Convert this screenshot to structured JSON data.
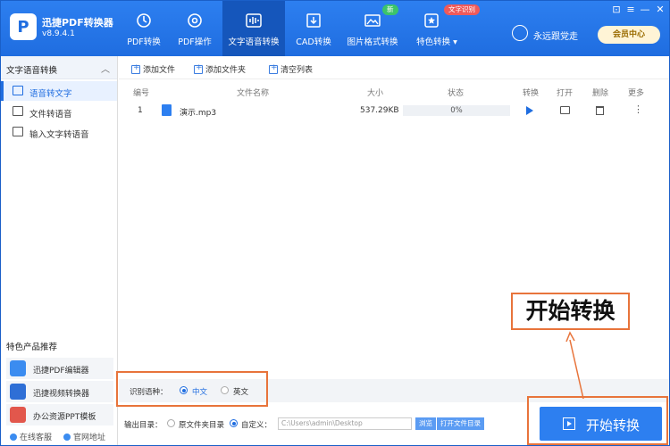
{
  "app": {
    "title": "迅捷PDF转换器",
    "version": "v8.9.4.1",
    "logo_letter": "P"
  },
  "nav": {
    "tabs": [
      {
        "label": "PDF转换",
        "icon": "refresh-icon"
      },
      {
        "label": "PDF操作",
        "icon": "settings-icon"
      },
      {
        "label": "文字语音转换",
        "icon": "waveform-icon",
        "active": true
      },
      {
        "label": "CAD转换",
        "icon": "download-box-icon"
      },
      {
        "label": "图片格式转换",
        "icon": "image-icon",
        "badge": "新"
      },
      {
        "label": "特色转换",
        "icon": "star-box-icon",
        "badge": "文字识别",
        "dropdown": "▾"
      }
    ]
  },
  "user": {
    "name": "永远跟党走",
    "vip_label": "会员中心"
  },
  "window_controls": {
    "skin": "⊡",
    "menu": "≡",
    "min": "—",
    "close": "✕"
  },
  "sidebar": {
    "section_title": "文字语音转换",
    "collapse_glyph": "︿",
    "items": [
      {
        "label": "语音转文字",
        "active": true
      },
      {
        "label": "文件转语音"
      },
      {
        "label": "输入文字转语音"
      }
    ],
    "recommend_title": "特色产品推荐",
    "recommend": [
      {
        "label": "迅捷PDF编辑器",
        "color": "#3b8cf0"
      },
      {
        "label": "迅捷视频转换器",
        "color": "#2f6fd6"
      },
      {
        "label": "办公资源PPT模板",
        "color": "#e2574c"
      }
    ],
    "footer": {
      "service": "在线客服",
      "website": "官网地址"
    }
  },
  "toolbar": {
    "add_file": "添加文件",
    "add_folder": "添加文件夹",
    "clear_list": "清空列表"
  },
  "table": {
    "headers": {
      "num": "编号",
      "name": "文件名称",
      "size": "大小",
      "status": "状态",
      "convert": "转换",
      "open": "打开",
      "delete": "删除",
      "more": "更多"
    },
    "rows": [
      {
        "num": "1",
        "name": "演示.mp3",
        "size": "537.29KB",
        "status": "0%",
        "progress": 0
      }
    ]
  },
  "language": {
    "label": "识别语种：",
    "options": [
      "中文",
      "英文"
    ],
    "selected": "中文"
  },
  "output": {
    "label": "输出目录：",
    "source_dir": "原文件夹目录",
    "custom": "自定义：",
    "path": "C:\\Users\\admin\\Desktop",
    "browse": "浏览",
    "open_dir": "打开文件目录"
  },
  "start_button": {
    "label": "开始转换"
  },
  "callout": {
    "text": "开始转换"
  },
  "colors": {
    "brand": "#1f6de0",
    "highlight": "#e8743b"
  }
}
